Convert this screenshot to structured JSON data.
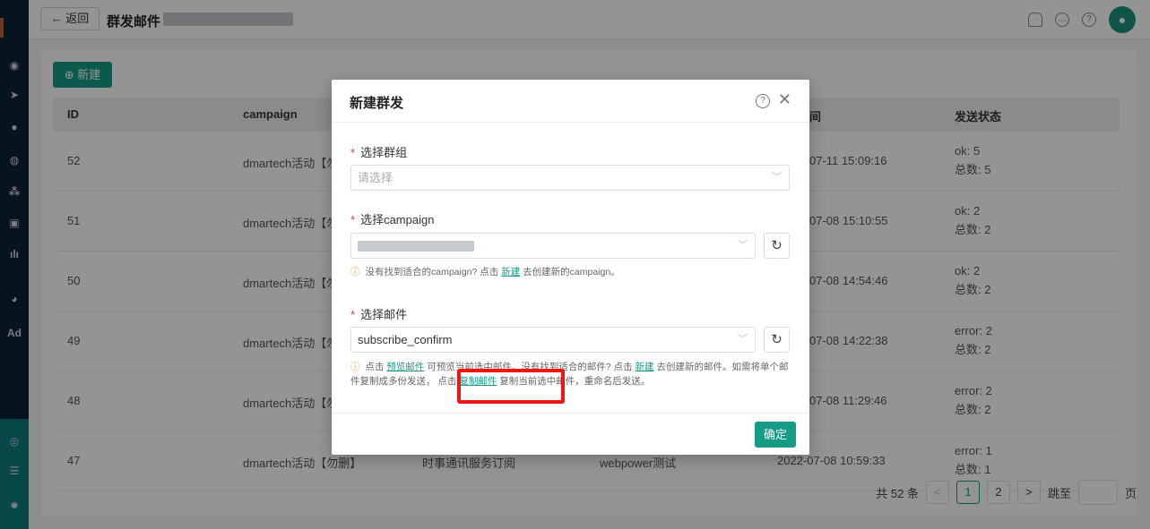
{
  "header": {
    "back_label": "← 返回",
    "title": "群发邮件"
  },
  "sidebar": {
    "items": [
      {
        "icon": "dashboard-icon",
        "glyph": "◉"
      },
      {
        "icon": "send-icon",
        "glyph": "➤"
      },
      {
        "icon": "user-icon",
        "glyph": "●"
      },
      {
        "icon": "users-icon",
        "glyph": "◍"
      },
      {
        "icon": "group-icon",
        "glyph": "⁂"
      },
      {
        "icon": "bookmark-icon",
        "glyph": "▣"
      },
      {
        "icon": "chart-icon",
        "glyph": "ılı"
      },
      {
        "icon": "chat-icon",
        "glyph": "◕"
      },
      {
        "icon": "ad-icon",
        "glyph": "Ad"
      },
      {
        "icon": "target-icon",
        "glyph": "◎"
      },
      {
        "icon": "server-icon",
        "glyph": "☰"
      },
      {
        "icon": "settings-icon",
        "glyph": "✹"
      }
    ]
  },
  "toolbar": {
    "new_label": "⊕ 新建"
  },
  "table": {
    "columns": [
      "ID",
      "campaign",
      "间",
      "发送状态"
    ],
    "rows": [
      {
        "id": "52",
        "campaign": "dmartech活动【勿",
        "c3": "",
        "c4": "",
        "time": "07-11 15:09:16",
        "status1": "ok: 5",
        "status2": "总数: 5"
      },
      {
        "id": "51",
        "campaign": "dmartech活动【勿",
        "c3": "",
        "c4": "",
        "time": "07-08 15:10:55",
        "status1": "ok: 2",
        "status2": "总数: 2"
      },
      {
        "id": "50",
        "campaign": "dmartech活动【勿",
        "c3": "",
        "c4": "",
        "time": "07-08 14:54:46",
        "status1": "ok: 2",
        "status2": "总数: 2"
      },
      {
        "id": "49",
        "campaign": "dmartech活动【勿",
        "c3": "",
        "c4": "",
        "time": "07-08 14:22:38",
        "status1": "error: 2",
        "status2": "总数: 2"
      },
      {
        "id": "48",
        "campaign": "dmartech活动【勿",
        "c3": "",
        "c4": "",
        "time": "07-08 11:29:46",
        "status1": "error: 2",
        "status2": "总数: 2"
      },
      {
        "id": "47",
        "campaign": "dmartech活动【勿删】",
        "c3": "时事通讯服务订阅",
        "c4": "webpower测试",
        "time": "2022-07-08 10:59:33",
        "status1": "error: 1",
        "status2": "总数: 1"
      }
    ]
  },
  "pagination": {
    "total": "共 52 条",
    "prev": "<",
    "pages": [
      "1",
      "2"
    ],
    "next": ">",
    "jump_label": "跳至",
    "page_suffix": "页"
  },
  "modal": {
    "title": "新建群发",
    "group_label": "选择群组",
    "group_placeholder": "请选择",
    "campaign_label": "选择campaign",
    "campaign_hint_a": "没有找到适合的campaign? 点击",
    "campaign_hint_link": "新建",
    "campaign_hint_b": "去创建新的campaign。",
    "mail_label": "选择邮件",
    "mail_value": "subscribe_confirm",
    "mail_hint_1": "点击",
    "mail_hint_preview": "预览邮件",
    "mail_hint_2": "可预览当前选中邮件。没有找到适合的邮件? 点击",
    "mail_hint_new": "新建",
    "mail_hint_3": "去创建新的邮件。如需将单个邮件复制成多份发送，",
    "mail_hint_4": "点击",
    "mail_hint_copy": "复制邮件",
    "mail_hint_5": "复制当前选中邮件，重命名后发送。",
    "ok_label": "确定"
  },
  "colors": {
    "primary": "#159b86",
    "highlight": "#f01515",
    "sidebar": "#0f2238"
  }
}
